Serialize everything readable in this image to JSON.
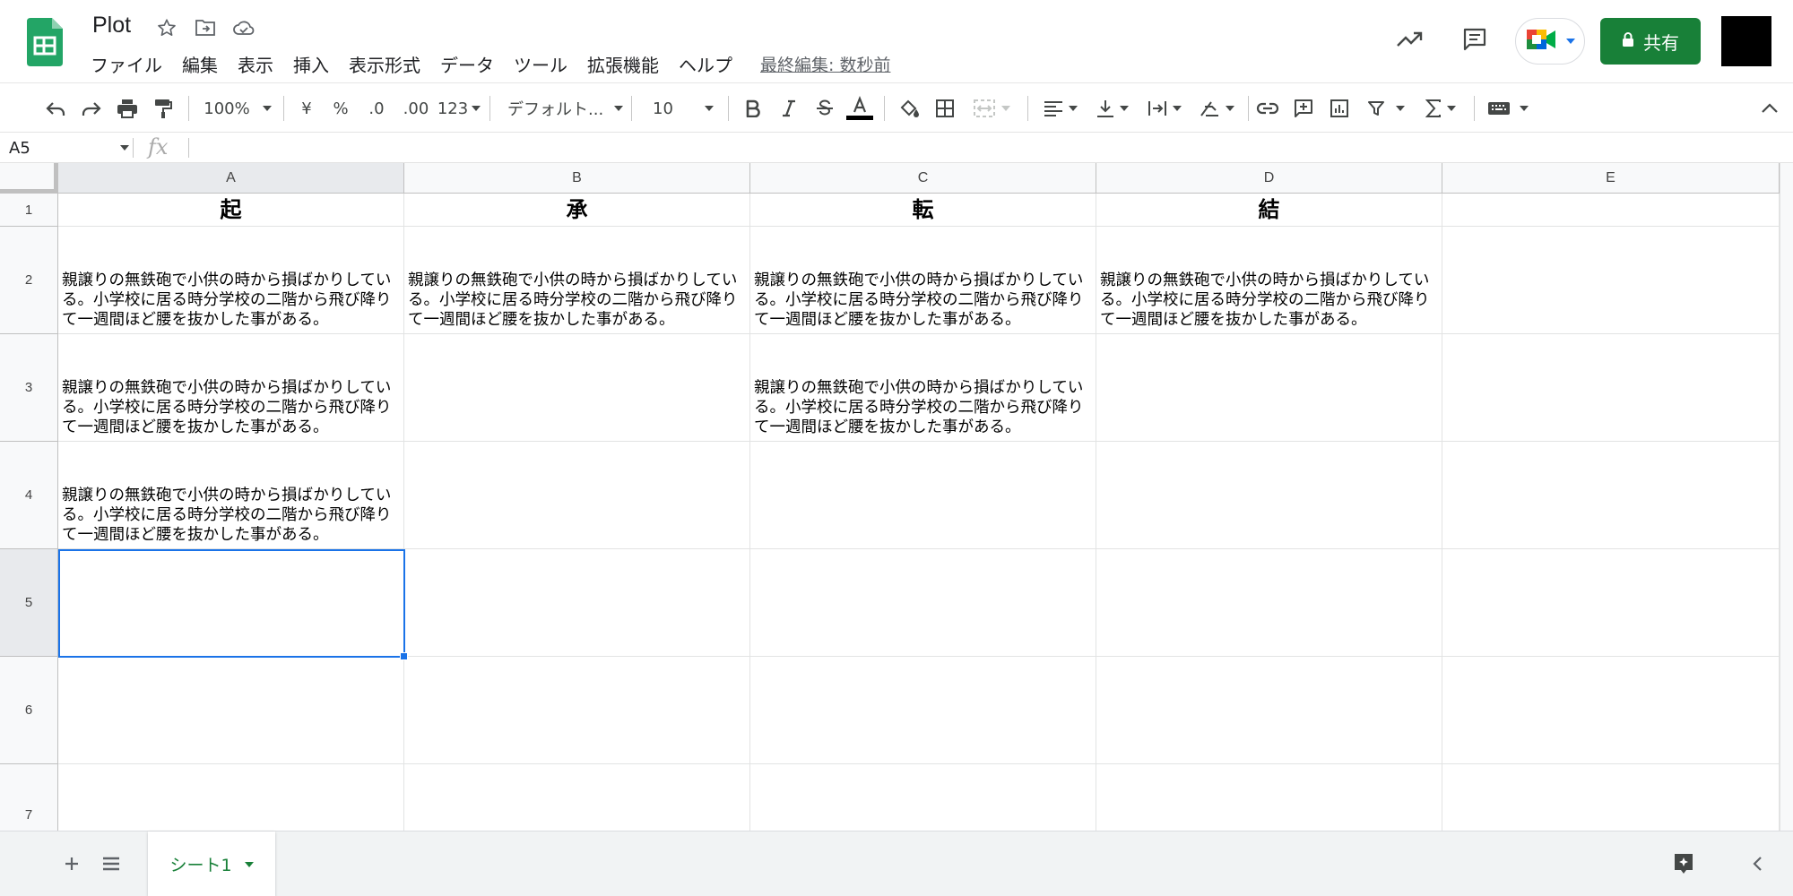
{
  "app": {
    "title": "Plot",
    "menu": [
      "ファイル",
      "編集",
      "表示",
      "挿入",
      "表示形式",
      "データ",
      "ツール",
      "拡張機能",
      "ヘルプ"
    ],
    "last_edit": "最終編集: 数秒前",
    "share_label": "共有",
    "accent_color": "#188038"
  },
  "toolbar": {
    "zoom": "100%",
    "currency": "¥",
    "percent": "%",
    "decrease_decimal": ".0",
    "increase_decimal": ".00",
    "more_formats": "123",
    "font": "デフォルト...",
    "font_size": "10"
  },
  "formula_bar": {
    "name_box": "A5",
    "fx": "fx"
  },
  "sheet": {
    "columns": [
      "A",
      "B",
      "C",
      "D",
      "E"
    ],
    "rows": [
      "1",
      "2",
      "3",
      "4",
      "5",
      "6",
      "7"
    ],
    "cells": {
      "A1": "起",
      "B1": "承",
      "C1": "転",
      "D1": "結",
      "A2": "親譲りの無鉄砲で小供の時から損ばかりしている。小学校に居る時分学校の二階から飛び降りて一週間ほど腰を抜かした事がある。",
      "B2": "親譲りの無鉄砲で小供の時から損ばかりしている。小学校に居る時分学校の二階から飛び降りて一週間ほど腰を抜かした事がある。",
      "C2": "親譲りの無鉄砲で小供の時から損ばかりしている。小学校に居る時分学校の二階から飛び降りて一週間ほど腰を抜かした事がある。",
      "D2": "親譲りの無鉄砲で小供の時から損ばかりしている。小学校に居る時分学校の二階から飛び降りて一週間ほど腰を抜かした事がある。",
      "A3": "親譲りの無鉄砲で小供の時から損ばかりしている。小学校に居る時分学校の二階から飛び降りて一週間ほど腰を抜かした事がある。",
      "C3": "親譲りの無鉄砲で小供の時から損ばかりしている。小学校に居る時分学校の二階から飛び降りて一週間ほど腰を抜かした事がある。",
      "A4": "親譲りの無鉄砲で小供の時から損ばかりしている。小学校に居る時分学校の二階から飛び降りて一週間ほど腰を抜かした事がある。"
    },
    "selected_cell": "A5",
    "tab_name": "シート1"
  }
}
